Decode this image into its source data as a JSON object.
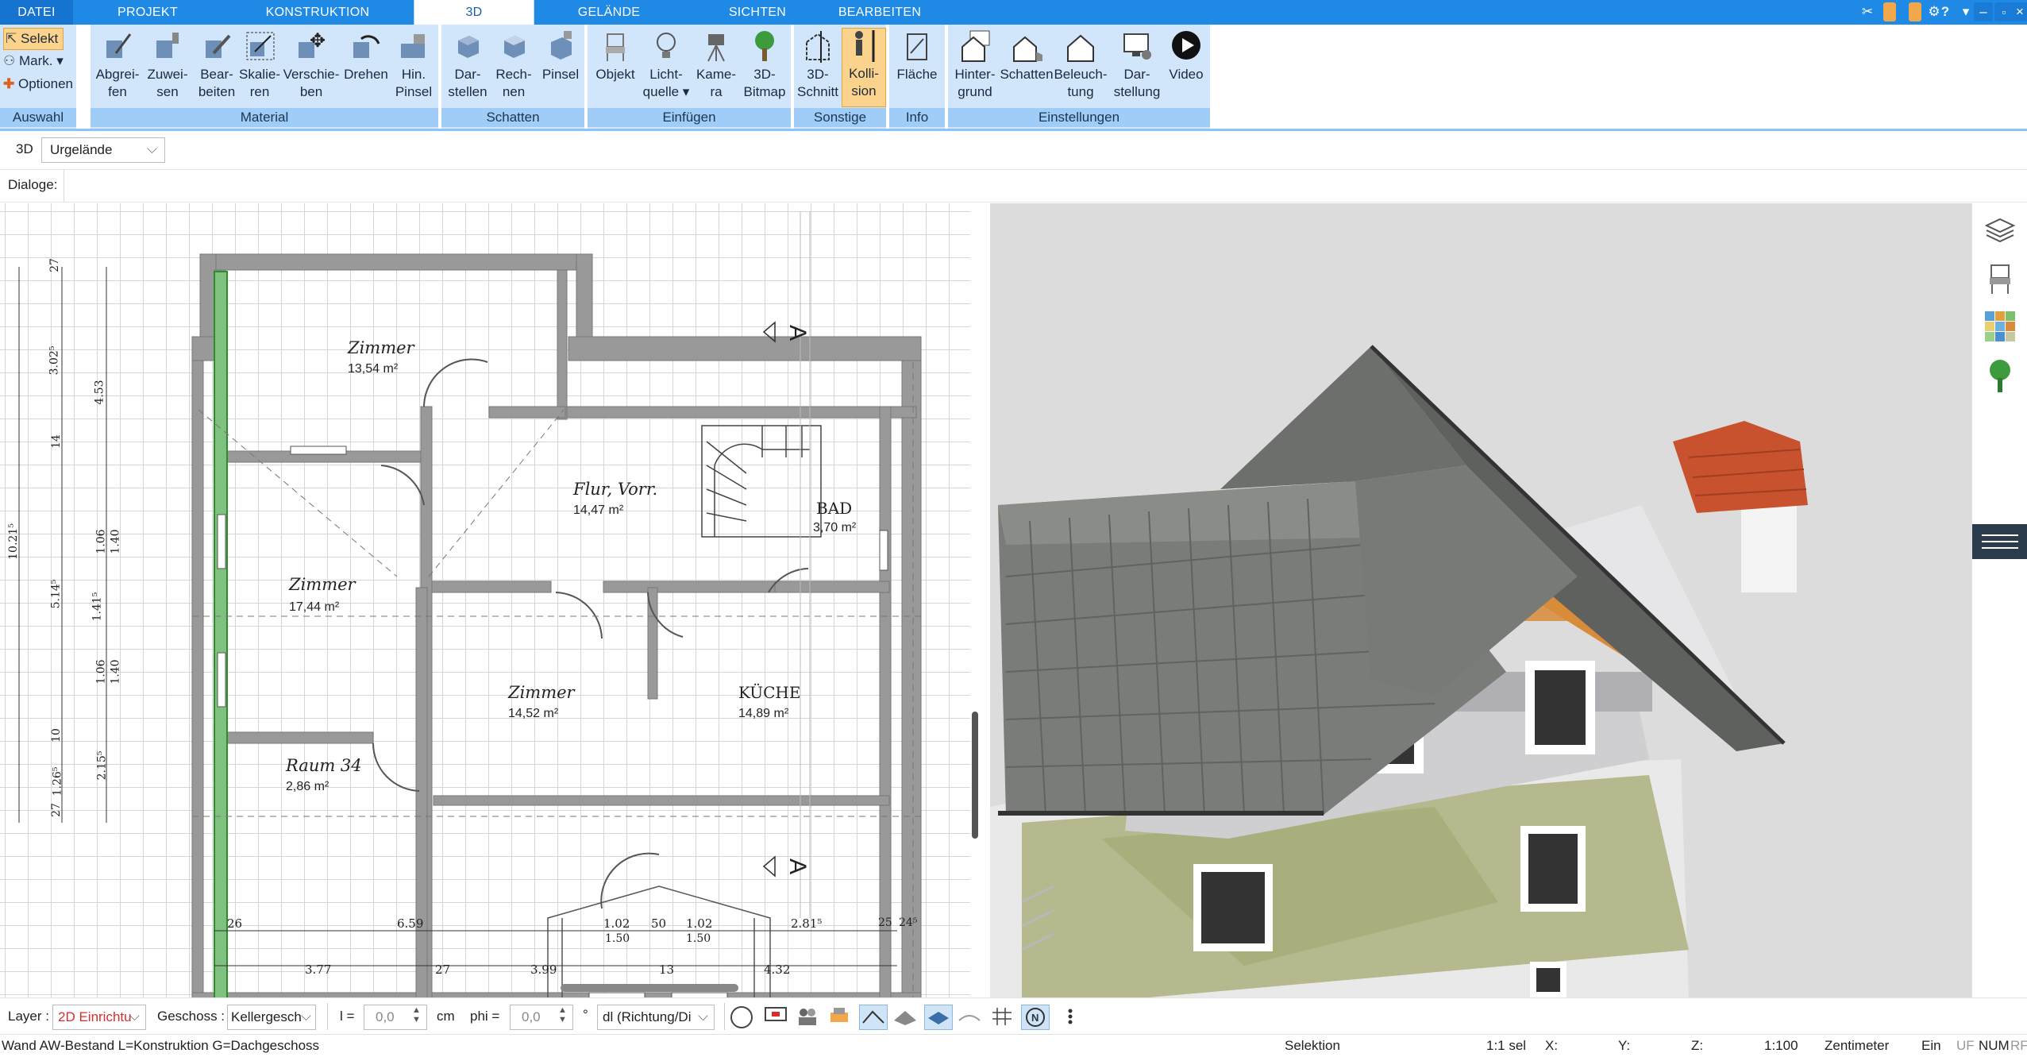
{
  "tabs": [
    {
      "label": "DATEI"
    },
    {
      "label": "PROJEKT"
    },
    {
      "label": "KONSTRUKTION"
    },
    {
      "label": "3D"
    },
    {
      "label": "GELÄNDE"
    },
    {
      "label": "SICHTEN"
    },
    {
      "label": "BEARBEITEN"
    }
  ],
  "active_tab": "3D",
  "auswahl": {
    "select": "Selekt",
    "mark": "Mark.",
    "options": "Optionen",
    "group": "Auswahl"
  },
  "material": {
    "group": "Material",
    "buttons": [
      {
        "l1": "Abgrei-",
        "l2": "fen"
      },
      {
        "l1": "Zuwei-",
        "l2": "sen"
      },
      {
        "l1": "Bear-",
        "l2": "beiten"
      },
      {
        "l1": "Skalie-",
        "l2": "ren"
      },
      {
        "l1": "Verschie-",
        "l2": "ben"
      },
      {
        "l1": "Drehen",
        "l2": ""
      },
      {
        "l1": "Hin.",
        "l2": "Pinsel"
      }
    ]
  },
  "schatten": {
    "group": "Schatten",
    "buttons": [
      {
        "l1": "Dar-",
        "l2": "stellen"
      },
      {
        "l1": "Rech-",
        "l2": "nen"
      },
      {
        "l1": "Pinsel",
        "l2": ""
      }
    ]
  },
  "einfuegen": {
    "group": "Einfügen",
    "buttons": [
      {
        "l1": "Objekt",
        "l2": ""
      },
      {
        "l1": "Licht-",
        "l2": "quelle"
      },
      {
        "l1": "Kame-",
        "l2": "ra"
      },
      {
        "l1": "3D-",
        "l2": "Bitmap"
      }
    ]
  },
  "sonstige": {
    "group": "Sonstige",
    "buttons": [
      {
        "l1": "3D-",
        "l2": "Schnitt"
      },
      {
        "l1": "Kolli-",
        "l2": "sion"
      }
    ]
  },
  "info": {
    "group": "Info",
    "buttons": [
      {
        "l1": "Fläche",
        "l2": ""
      }
    ]
  },
  "einstellungen": {
    "group": "Einstellungen",
    "buttons": [
      {
        "l1": "Hinter-",
        "l2": "grund"
      },
      {
        "l1": "Schatten",
        "l2": ""
      },
      {
        "l1": "Beleuch-",
        "l2": "tung"
      },
      {
        "l1": "Dar-",
        "l2": "stellung"
      },
      {
        "l1": "Video",
        "l2": ""
      }
    ]
  },
  "bar2": {
    "mode": "3D",
    "terrain": "Urgelände"
  },
  "bar3": {
    "dialoge": "Dialoge:"
  },
  "plan": {
    "rooms": [
      {
        "name": "Zimmer",
        "area": "13,54 m²"
      },
      {
        "name": "Flur, Vorr.",
        "area": "14,47 m²"
      },
      {
        "name": "BAD",
        "area": "3,70 m²"
      },
      {
        "name": "Zimmer",
        "area": "17,44 m²"
      },
      {
        "name": "Zimmer",
        "area": "14,52 m²"
      },
      {
        "name": "KÜCHE",
        "area": "14,89 m²"
      },
      {
        "name": "Raum 34",
        "area": "2,86 m²"
      }
    ],
    "section_mark": "A",
    "dims_bottom1": [
      "26",
      "6.59",
      "1.02",
      "50",
      "1.02",
      "2.81⁵",
      "25",
      "24⁵"
    ],
    "dims_bottom1_sub": [
      "1.50",
      "1.50"
    ],
    "dims_bottom2": [
      "3.77",
      "27",
      "3.99",
      "13",
      "4.32"
    ],
    "dims_left": [
      "27",
      "3.02⁵",
      "4.53",
      "14",
      "1.06",
      "1.40",
      "10.21⁵",
      "5.14⁵",
      "1.41⁵",
      "1.06",
      "1.40",
      "10",
      "1.26⁵",
      "27",
      "2.15⁵"
    ]
  },
  "bottombar": {
    "layer_label": "Layer :",
    "layer_value": "2D Einrichtu",
    "geschoss_label": "Geschoss :",
    "geschoss_value": "Kellergesch",
    "l_label": "l =",
    "l_value": "0,0",
    "l_unit": "cm",
    "phi_label": "phi =",
    "phi_value": "0,0",
    "phi_unit": "°",
    "direction_value": "dl (Richtung/Di"
  },
  "statusbar": {
    "left": "Wand AW-Bestand L=Konstruktion G=Dachgeschoss",
    "mode": "Selektion",
    "sel": "1:1 sel",
    "x": "X:",
    "y": "Y:",
    "z": "Z:",
    "scale": "1:100",
    "unit": "Zentimeter",
    "ein": "Ein",
    "uf": "UF",
    "num": "NUM",
    "rf": "RF"
  },
  "colors": {
    "ribbon_blue": "#1e8ae6",
    "group_bg": "#d2e6fb",
    "group_label": "#9fcdf7",
    "active_btn": "#fbd38d"
  }
}
